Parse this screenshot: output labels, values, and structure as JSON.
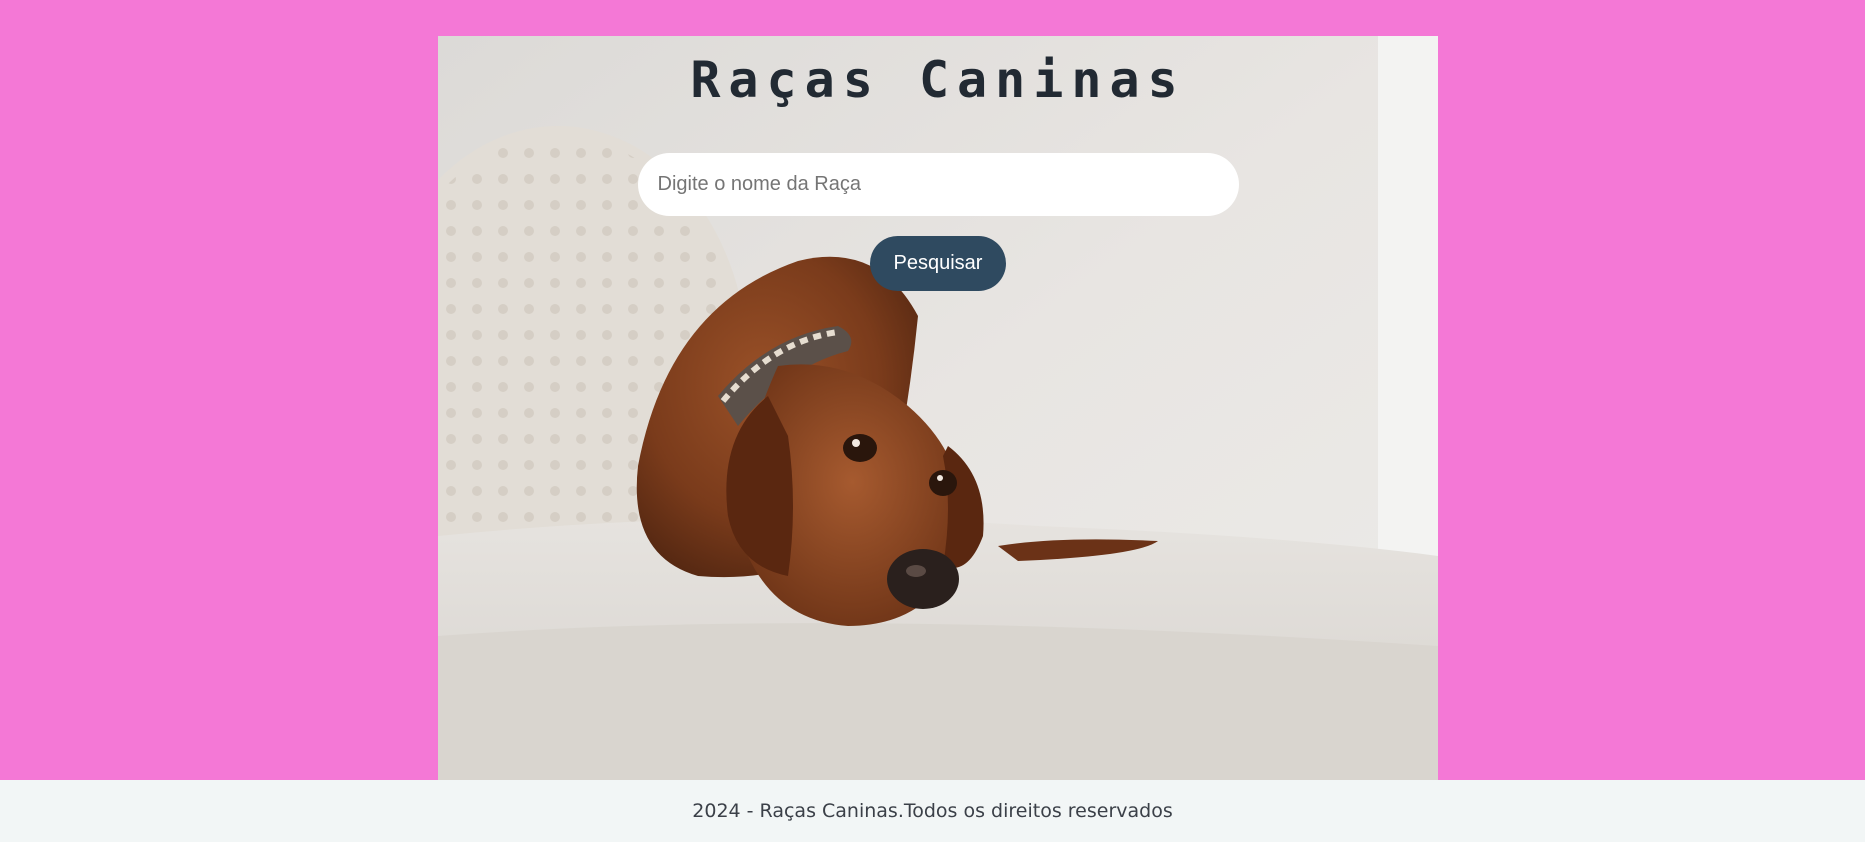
{
  "header": {
    "title": "Raças Caninas"
  },
  "search": {
    "placeholder": "Digite o nome da Raça",
    "value": "",
    "button_label": "Pesquisar"
  },
  "hero_image": {
    "subject": "dachshund-on-sofa"
  },
  "footer": {
    "text": "2024 - Raças Caninas.Todos os direitos reservados"
  },
  "colors": {
    "page_background": "#f478d6",
    "title": "#222a33",
    "button": "#2f4a60",
    "footer_background": "#f2f6f6",
    "footer_text": "#3b4048"
  }
}
